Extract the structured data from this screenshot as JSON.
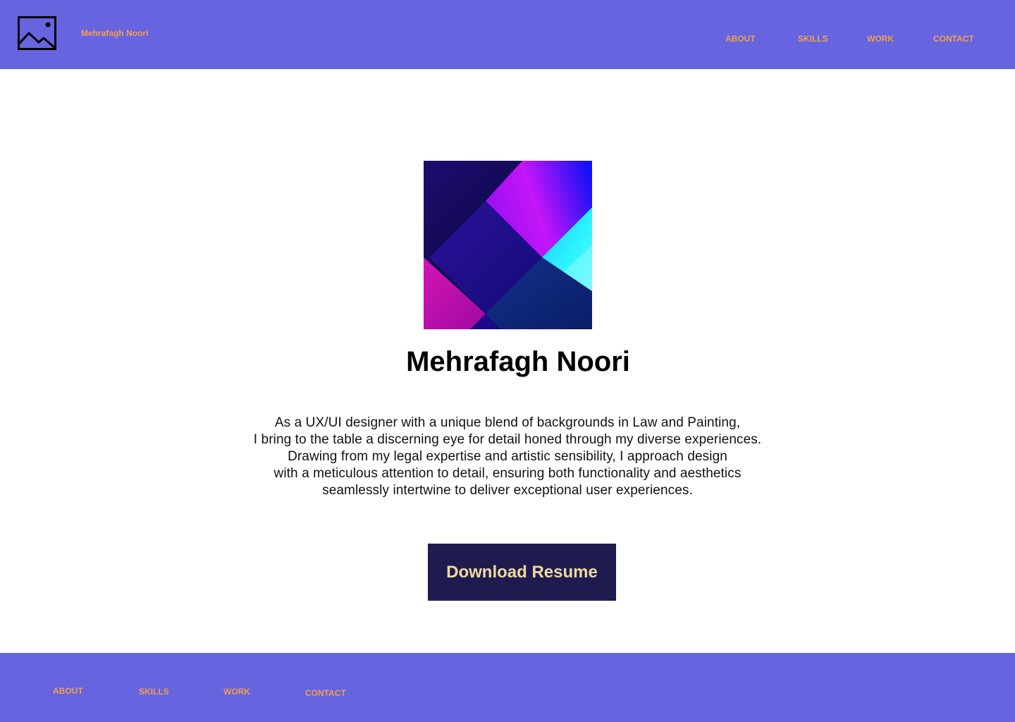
{
  "header": {
    "logo_icon": "image-placeholder-icon",
    "brand_name": "Mehrafagh Noori",
    "nav": [
      "ABOUT",
      "SKILLS",
      "WORK",
      "CONTACT"
    ]
  },
  "hero": {
    "profile_image_icon": "abstract-geometric-artwork",
    "name": "Mehrafagh Noori",
    "bio_lines": [
      "As a UX/UI designer with a unique blend of backgrounds in Law and Painting,",
      "I bring to the table a discerning eye for detail honed through my diverse experiences.",
      "Drawing from my legal expertise and artistic sensibility, I approach design",
      "with a meticulous attention to detail, ensuring both functionality and aesthetics",
      "seamlessly intertwine to deliver exceptional user experiences."
    ],
    "download_label": "Download Resume"
  },
  "footer": {
    "nav": [
      "ABOUT",
      "SKILLS",
      "WORK",
      "CONTACT"
    ]
  },
  "colors": {
    "header_bg": "#6764e0",
    "nav_text": "#f0a050",
    "button_bg": "#1e1c4e",
    "button_text": "#efd9a1"
  }
}
